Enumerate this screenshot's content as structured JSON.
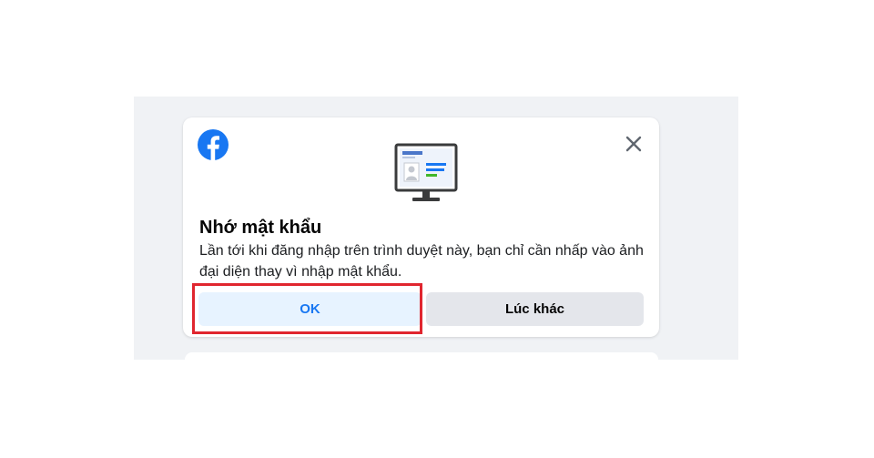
{
  "dialog": {
    "title": "Nhớ mật khẩu",
    "description": "Lần tới khi đăng nhập trên trình duyệt này, bạn chỉ cần nhấp vào ảnh đại diện thay vì nhập mật khẩu.",
    "ok_label": "OK",
    "later_label": "Lúc khác",
    "logo_icon": "facebook-logo-icon",
    "close_icon": "close-icon",
    "illustration_icon": "monitor-illustration-icon",
    "illustration_text": "facebook"
  },
  "colors": {
    "brand": "#1877f2",
    "ok_bg": "#e7f3ff",
    "later_bg": "#e4e6eb",
    "highlight": "#e0262f",
    "backdrop": "#f0f2f5"
  }
}
